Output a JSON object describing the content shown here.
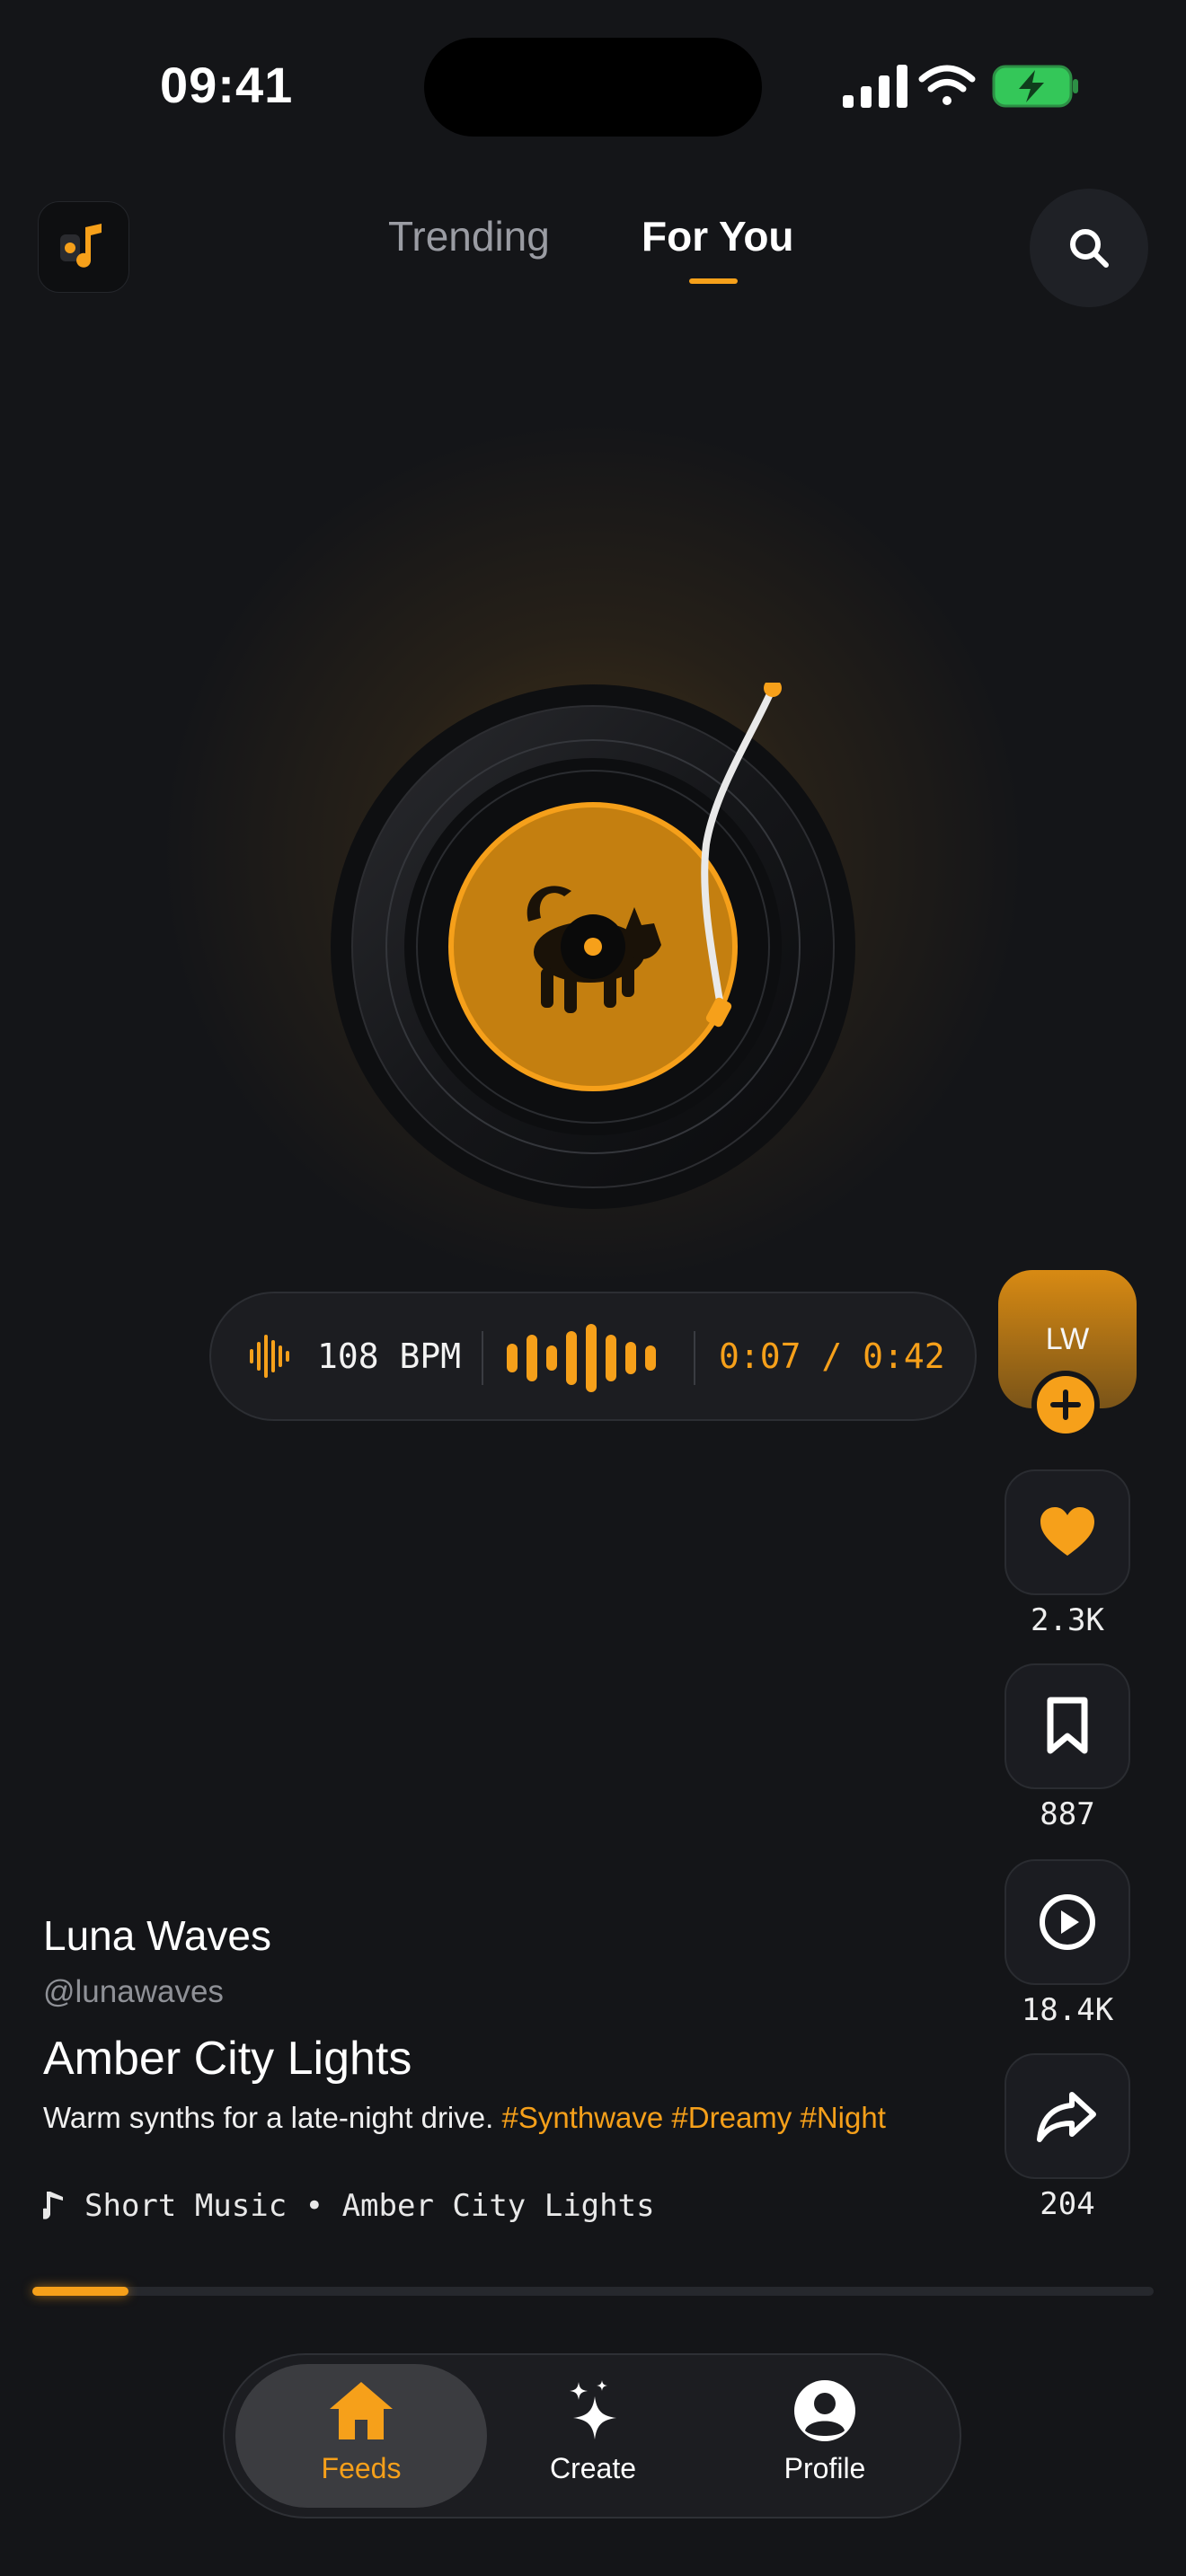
{
  "status_bar": {
    "time": "09:41"
  },
  "header": {
    "tabs": [
      {
        "label": "Trending",
        "active": false
      },
      {
        "label": "For You",
        "active": true
      }
    ]
  },
  "player": {
    "bpm_label": "108 BPM",
    "time_label": "0:07 / 0:42",
    "progress_fraction": 0.086
  },
  "creator": {
    "initials": "LW"
  },
  "actions": {
    "likes": "2.3K",
    "saves": "887",
    "plays": "18.4K",
    "shares": "204"
  },
  "meta": {
    "artist": "Luna Waves",
    "handle": "@lunawaves",
    "title": "Amber City Lights",
    "description": "Warm synths for a late-night drive.",
    "tags": [
      "#Synthwave",
      "#Dreamy",
      "#Night"
    ],
    "music_source": "Short Music • Amber City Lights"
  },
  "nav": {
    "items": [
      {
        "label": "Feeds",
        "active": true
      },
      {
        "label": "Create",
        "active": false
      },
      {
        "label": "Profile",
        "active": false
      }
    ]
  },
  "colors": {
    "accent": "#F6A01A",
    "background": "#141518",
    "surface": "#1C1D21",
    "battery": "#34C759"
  },
  "icons": [
    "signal-icon",
    "wifi-icon",
    "battery-icon",
    "app-music-icon",
    "search-icon",
    "vinyl-record-icon",
    "cat-icon",
    "waveform-icon",
    "plus-icon",
    "heart-icon",
    "bookmark-icon",
    "play-icon",
    "share-icon",
    "music-note-icon",
    "home-icon",
    "sparkle-icon",
    "profile-icon"
  ]
}
